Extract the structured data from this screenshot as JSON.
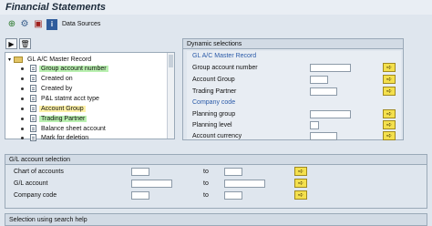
{
  "window": {
    "title": "Financial Statements"
  },
  "toolbar": {
    "data_sources_label": "Data Sources"
  },
  "tree": {
    "root": "GL A/C Master Record",
    "items": [
      {
        "label": "Group account number",
        "highlight": "green"
      },
      {
        "label": "Created on",
        "highlight": ""
      },
      {
        "label": "Created by",
        "highlight": ""
      },
      {
        "label": "P&L statmt acct type",
        "highlight": ""
      },
      {
        "label": "Account Group",
        "highlight": "yellow"
      },
      {
        "label": "Trading Partner",
        "highlight": "green"
      },
      {
        "label": "Balance sheet account",
        "highlight": ""
      },
      {
        "label": "Mark for deletion",
        "highlight": ""
      }
    ]
  },
  "dynamic": {
    "header": "Dynamic selections",
    "sec1_title": "GL A/C Master Record",
    "sec2_title": "Company code",
    "fields": [
      {
        "label": "Group account number"
      },
      {
        "label": "Account Group"
      },
      {
        "label": "Trading Partner"
      },
      {
        "label": "Planning group"
      },
      {
        "label": "Planning level"
      },
      {
        "label": "Account currency"
      }
    ]
  },
  "gl_selection": {
    "header": "G/L account selection",
    "to_label": "to",
    "rows": [
      {
        "label": "Chart of accounts"
      },
      {
        "label": "G/L account"
      },
      {
        "label": "Company code"
      }
    ]
  },
  "search_help": {
    "header": "Selection using search help"
  },
  "colors": {
    "highlight_green": "#b9f0b0",
    "highlight_yellow": "#fff2a8",
    "section_blue": "#2a5aa8",
    "arrow_button": "#f4e04d"
  }
}
